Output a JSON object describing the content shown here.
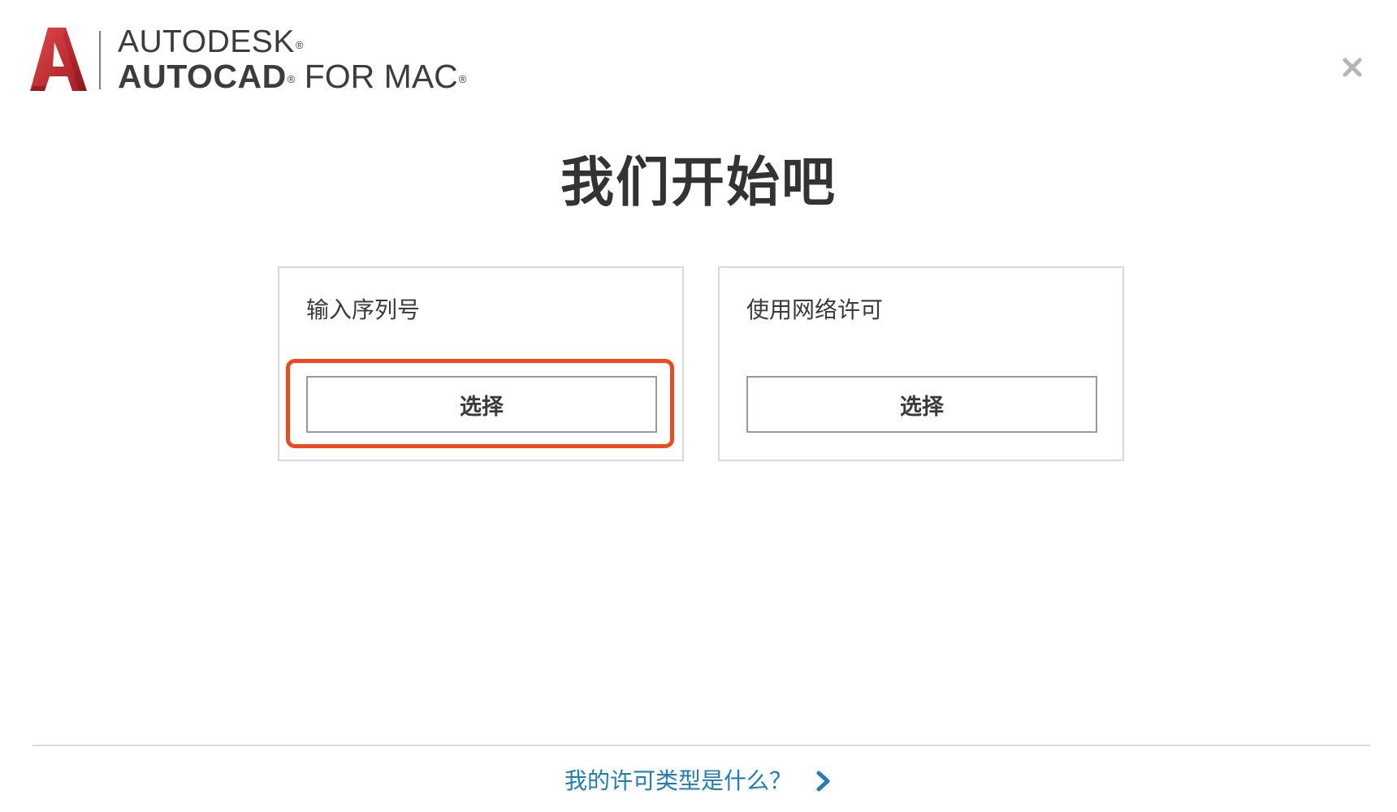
{
  "brand": {
    "company": "AUTODESK",
    "product_bold": "AUTOCAD",
    "product_suffix": "FOR MAC",
    "registered_mark": "®",
    "logo_icon": "autocad-a-logo",
    "logo_color": "#c8282d"
  },
  "window": {
    "close_icon": "close-icon"
  },
  "main": {
    "title": "我们开始吧"
  },
  "options": [
    {
      "label": "输入序列号",
      "button_label": "选择",
      "highlighted": true
    },
    {
      "label": "使用网络许可",
      "button_label": "选择",
      "highlighted": false
    }
  ],
  "footer": {
    "link_text": "我的许可类型是什么？",
    "link_icon": "chevron-right-icon",
    "link_color": "#1e7fb8"
  },
  "colors": {
    "highlight": "#f04a1c",
    "text": "#333333",
    "card_border": "#d8d8d8"
  }
}
